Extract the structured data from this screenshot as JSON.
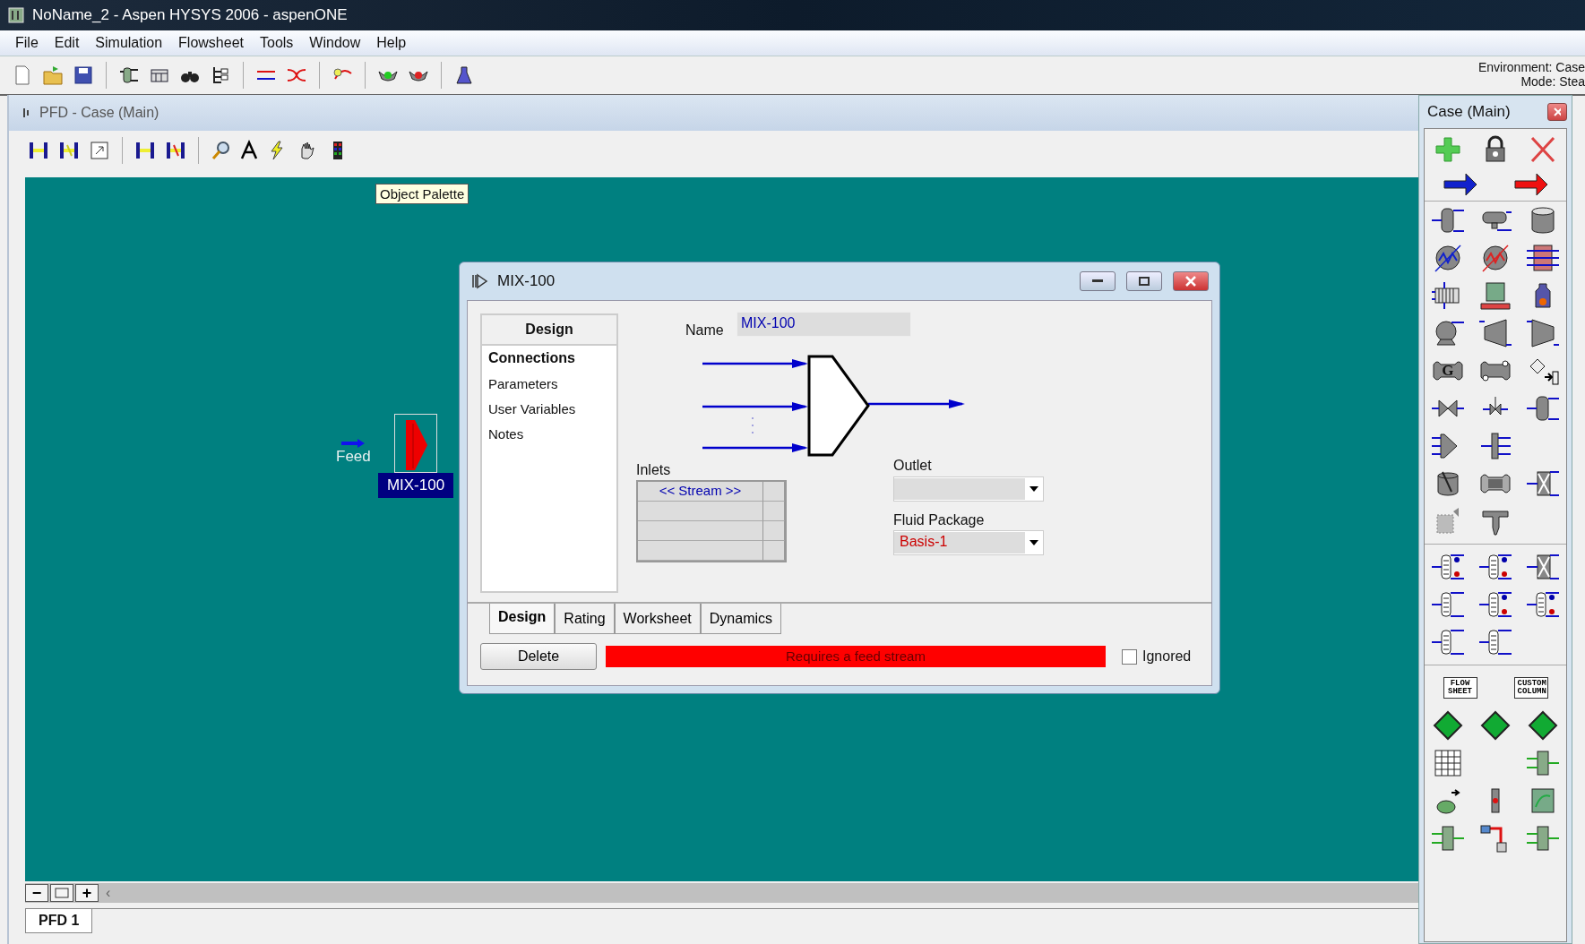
{
  "window": {
    "title": "NoName_2 - Aspen HYSYS 2006 - aspenONE"
  },
  "menu": [
    "File",
    "Edit",
    "Simulation",
    "Flowsheet",
    "Tools",
    "Window",
    "Help"
  ],
  "status": {
    "environment": "Environment: Case",
    "mode": "Mode: Stea"
  },
  "pfd": {
    "title": "PFD - Case (Main)",
    "tooltip": "Object Palette",
    "zoom_buttons": [
      "−",
      "+"
    ],
    "scroll_left": "‹",
    "tabs": [
      {
        "label": "PFD 1",
        "selected": true
      }
    ],
    "stream": {
      "label": "Feed"
    },
    "unit": {
      "label": "MIX-100",
      "selected": true
    }
  },
  "dialog": {
    "title": "MIX-100",
    "nav": {
      "header": "Design",
      "items": [
        {
          "label": "Connections",
          "selected": true
        },
        {
          "label": "Parameters",
          "selected": false
        },
        {
          "label": "User Variables",
          "selected": false
        },
        {
          "label": "Notes",
          "selected": false
        }
      ]
    },
    "name_label": "Name",
    "name_value": "MIX-100",
    "inlets": {
      "label": "Inlets",
      "header": "<< Stream >>"
    },
    "outlet": {
      "label": "Outlet"
    },
    "fluid_package": {
      "label": "Fluid Package",
      "value": "Basis-1"
    },
    "tabs": [
      {
        "label": "Design",
        "selected": true
      },
      {
        "label": "Rating",
        "selected": false
      },
      {
        "label": "Worksheet",
        "selected": false
      },
      {
        "label": "Dynamics",
        "selected": false
      }
    ],
    "delete_button": "Delete",
    "status_text": "Requires a feed stream",
    "ignored": {
      "label": "Ignored",
      "checked": false
    }
  },
  "palette": {
    "title": "Case (Main)",
    "generator_letter": "G",
    "flowsheet_button": "FLOW SHEET",
    "custom_column_button": "CUSTOM COLUMN"
  }
}
